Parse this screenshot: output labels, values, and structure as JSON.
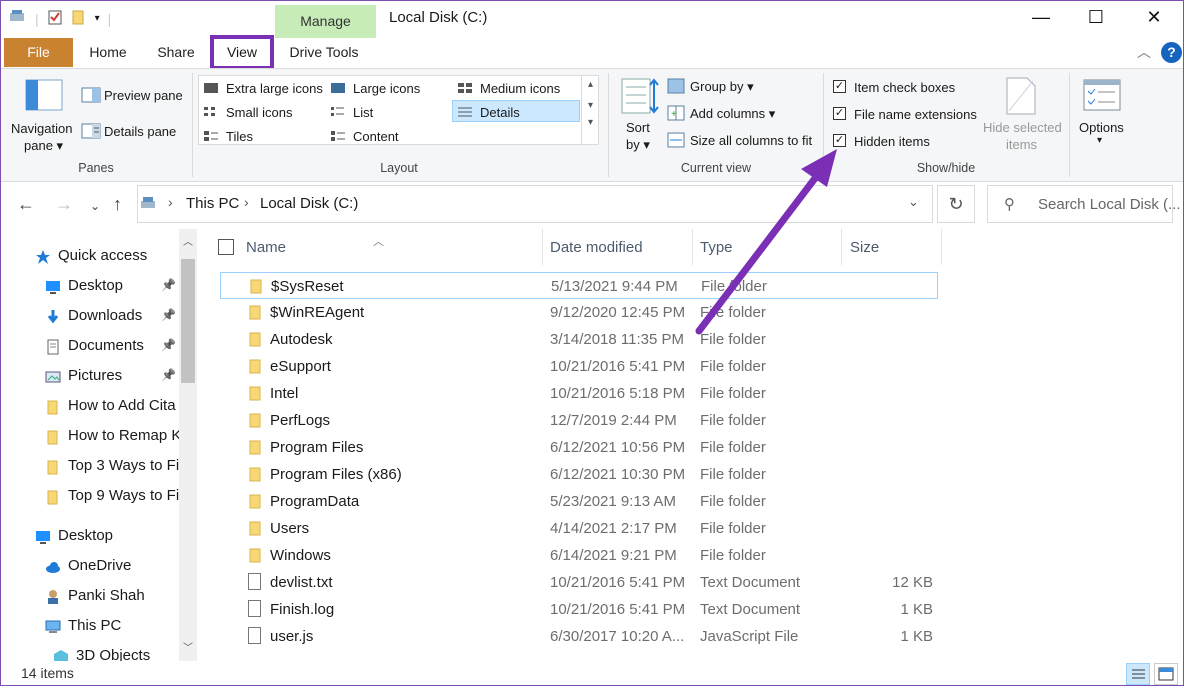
{
  "window": {
    "manage_tab": "Manage",
    "title": "Local Disk (C:)",
    "controls": [
      "—",
      "☐",
      "✕"
    ]
  },
  "tabs": {
    "file": "File",
    "home": "Home",
    "share": "Share",
    "view": "View",
    "drive_tools": "Drive Tools"
  },
  "ribbon": {
    "panes": {
      "navigation_pane": "Navigation",
      "navigation_pane_2": "pane",
      "preview_pane": "Preview pane",
      "details_pane": "Details pane",
      "group_label": "Panes"
    },
    "layout": {
      "extra_large_icons": "Extra large icons",
      "large_icons": "Large icons",
      "medium_icons": "Medium icons",
      "small_icons": "Small icons",
      "list": "List",
      "details": "Details",
      "tiles": "Tiles",
      "content": "Content",
      "group_label": "Layout"
    },
    "current_view": {
      "sort_by": "Sort",
      "sort_by_2": "by",
      "group_by": "Group by",
      "add_columns": "Add columns",
      "size_all_columns": "Size all columns to fit",
      "group_label": "Current view"
    },
    "show_hide": {
      "item_check_boxes": "Item check boxes",
      "file_name_extensions": "File name extensions",
      "hidden_items": "Hidden items",
      "hide_selected": "Hide selected",
      "hide_selected_2": "items",
      "group_label": "Show/hide"
    },
    "options": "Options"
  },
  "address": {
    "this_pc": "This PC",
    "separator": "›",
    "location": "Local Disk (C:)",
    "search_placeholder": "Search Local Disk (..."
  },
  "nav": {
    "items": [
      {
        "label": "Quick access",
        "icon": "star-icon",
        "pinned": false,
        "indent": 1
      },
      {
        "label": "Desktop",
        "icon": "desktop-icon",
        "pinned": true,
        "indent": 2
      },
      {
        "label": "Downloads",
        "icon": "download-icon",
        "pinned": true,
        "indent": 2
      },
      {
        "label": "Documents",
        "icon": "documents-icon",
        "pinned": true,
        "indent": 2
      },
      {
        "label": "Pictures",
        "icon": "pictures-icon",
        "pinned": true,
        "indent": 2
      },
      {
        "label": "How to Add Cita",
        "icon": "folder-icon",
        "pinned": false,
        "indent": 2
      },
      {
        "label": "How to Remap K",
        "icon": "folder-icon",
        "pinned": false,
        "indent": 2
      },
      {
        "label": "Top 3 Ways to Fi",
        "icon": "folder-icon",
        "pinned": false,
        "indent": 2
      },
      {
        "label": "Top 9 Ways to Fi",
        "icon": "folder-icon",
        "pinned": false,
        "indent": 2
      },
      {
        "label": "Desktop",
        "icon": "desktop-icon",
        "pinned": false,
        "indent": 1
      },
      {
        "label": "OneDrive",
        "icon": "cloud-icon",
        "pinned": false,
        "indent": 2
      },
      {
        "label": "Panki Shah",
        "icon": "user-icon",
        "pinned": false,
        "indent": 2
      },
      {
        "label": "This PC",
        "icon": "pc-icon",
        "pinned": false,
        "indent": 2
      },
      {
        "label": "3D Objects",
        "icon": "cube-icon",
        "pinned": false,
        "indent": 3
      }
    ]
  },
  "columns": {
    "name": "Name",
    "date_modified": "Date modified",
    "type": "Type",
    "size": "Size"
  },
  "files": [
    {
      "name": "$SysReset",
      "date": "5/13/2021 9:44 PM",
      "type": "File folder",
      "size": "",
      "kind": "folder"
    },
    {
      "name": "$WinREAgent",
      "date": "9/12/2020 12:45 PM",
      "type": "File folder",
      "size": "",
      "kind": "folder"
    },
    {
      "name": "Autodesk",
      "date": "3/14/2018 11:35 PM",
      "type": "File folder",
      "size": "",
      "kind": "folder"
    },
    {
      "name": "eSupport",
      "date": "10/21/2016 5:41 PM",
      "type": "File folder",
      "size": "",
      "kind": "folder"
    },
    {
      "name": "Intel",
      "date": "10/21/2016 5:18 PM",
      "type": "File folder",
      "size": "",
      "kind": "folder"
    },
    {
      "name": "PerfLogs",
      "date": "12/7/2019 2:44 PM",
      "type": "File folder",
      "size": "",
      "kind": "folder"
    },
    {
      "name": "Program Files",
      "date": "6/12/2021 10:56 PM",
      "type": "File folder",
      "size": "",
      "kind": "folder"
    },
    {
      "name": "Program Files (x86)",
      "date": "6/12/2021 10:30 PM",
      "type": "File folder",
      "size": "",
      "kind": "folder"
    },
    {
      "name": "ProgramData",
      "date": "5/23/2021 9:13 AM",
      "type": "File folder",
      "size": "",
      "kind": "folder"
    },
    {
      "name": "Users",
      "date": "4/14/2021 2:17 PM",
      "type": "File folder",
      "size": "",
      "kind": "folder"
    },
    {
      "name": "Windows",
      "date": "6/14/2021 9:21 PM",
      "type": "File folder",
      "size": "",
      "kind": "folder"
    },
    {
      "name": "devlist.txt",
      "date": "10/21/2016 5:41 PM",
      "type": "Text Document",
      "size": "12 KB",
      "kind": "file"
    },
    {
      "name": "Finish.log",
      "date": "10/21/2016 5:41 PM",
      "type": "Text Document",
      "size": "1 KB",
      "kind": "file"
    },
    {
      "name": "user.js",
      "date": "6/30/2017 10:20 A...",
      "type": "JavaScript File",
      "size": "1 KB",
      "kind": "file"
    }
  ],
  "status": {
    "item_count": "14 items"
  },
  "colors": {
    "accent": "#7b2fb5",
    "file_tab": "#c98230",
    "manage_tab": "#c8ecb8",
    "folder": "#f8d775",
    "selection": "#cce8ff"
  }
}
